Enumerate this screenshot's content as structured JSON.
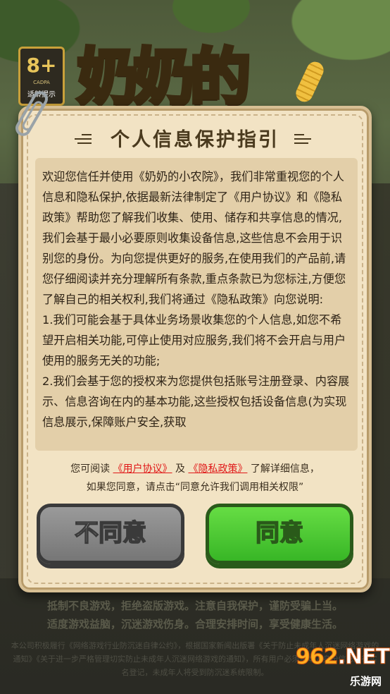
{
  "background": {
    "age_rating": "8+",
    "age_org": "CADPA",
    "age_tip": "适龄提示",
    "game_title": "奶奶的"
  },
  "dialog": {
    "title": "个人信息保护指引",
    "policy_text": "欢迎您信任并使用《奶奶的小农院》，我们非常重视您的个人信息和隐私保护,依据最新法律制定了《用户协议》和《隐私政策》帮助您了解我们收集、使用、储存和共享信息的情况,我们会基于最小必要原则收集设备信息,这些信息不会用于识别您的身份。为向您提供更好的服务,在使用我们的产品前,请您仔细阅读并充分理解所有条款,重点条款已为您标注,方便您了解自己的相关权利,我们将通过《隐私政策》向您说明:\n1.我们可能会基于具体业务场景收集您的个人信息,如您不希望开启相关功能,可停止使用对应服务,我们将不会开启与用户使用的服务无关的功能;\n2.我们会基于您的授权来为您提供包括账号注册登录、内容展示、信息咨询在内的基本功能,这些授权包括设备信息(为实现信息展示,保障账户安全,获取",
    "footer_prefix": "您可阅读",
    "link_user_agreement": "《用户协议》",
    "footer_and": "及",
    "link_privacy_policy": "《隐私政策》",
    "footer_suffix": "了解详细信息，",
    "footer_line2": "如果您同意，请点击“同意允许我们调用相关权限”",
    "disagree_label": "不同意",
    "agree_label": "同意"
  },
  "health_notice": {
    "line1": "抵制不良游戏，拒绝盗版游戏。注意自我保护，谨防受骗上当。",
    "line2": "适度游戏益脑，沉迷游戏伤身。合理安排时间，享受健康生活。",
    "legal": "本公司积极履行《网络游戏行业防沉迷自律公约》，根据国家新闻出版署《关于防止未成年人沉迷网络游戏的通知》《关于进一步严格管理切实防止未成年人沉迷网络游戏的通知》，所有用户必须用本人身份信息进行实名登记，未成年人将受到防沉迷系统限制。"
  },
  "watermark": {
    "logo_num": "962",
    "logo_suffix": ".NET",
    "sub": "乐游网"
  }
}
